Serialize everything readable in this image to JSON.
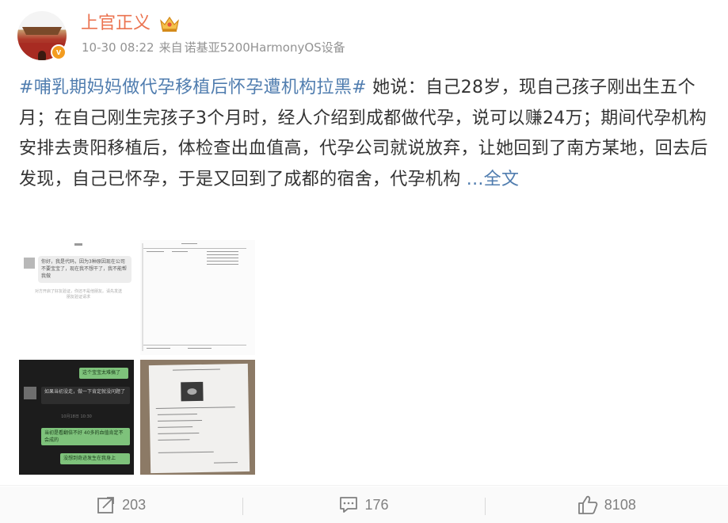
{
  "post": {
    "author": {
      "name": "上官正义",
      "verified_badge": "v",
      "avatar": "avatar-tiananmen",
      "badge_icon": "crown-icon"
    },
    "meta": {
      "time": "10-30 08:22",
      "source_prefix": "来自",
      "source": "诺基亚5200HarmonyOS设备"
    },
    "content": {
      "hashtag": "#哺乳期妈妈做代孕移植后怀孕遭机构拉黑#",
      "text": " 她说：自己28岁，现自己孩子刚出生五个月；在自己刚生完孩子3个月时，经人介绍到成都做代孕，说可以赚24万；期间代孕机构安排去贵阳移植后，体检查出血值高，代孕公司就说放弃，让她回到了南方某地，回去后发现，自己已怀孕，于是又回到了成都的宿舍，代孕机构 ",
      "more_label": "...全文"
    },
    "images": [
      {
        "name": "chat-screenshot-white",
        "bubble": "你好，我是代码，因为3种原因现在公司不要宝宝了，现在我不想干了，我不能帮我做",
        "tip": "对方开启了好友验证，你还不是他朋友。请先发送朋友验证请求"
      },
      {
        "name": "medical-report-document"
      },
      {
        "name": "chat-screenshot-dark",
        "bubbles_green": [
          "这个宝宝太难搞了",
          "当初是看翻倍不好 40多的血值肯定不会成的",
          "没想到奇迹发生在我身上"
        ],
        "bubble_dark": "如果当初没走，做一下肯定就没问题了",
        "time": "10月18日 10:30"
      },
      {
        "name": "ultrasound-report-photo"
      }
    ],
    "actions": {
      "repost": "203",
      "comment": "176",
      "like": "8108"
    }
  },
  "colors": {
    "author": "#eb7350",
    "link": "#507daf",
    "meta": "#939393",
    "footer_bg": "#fafafa",
    "badge": "#f39c1f"
  }
}
